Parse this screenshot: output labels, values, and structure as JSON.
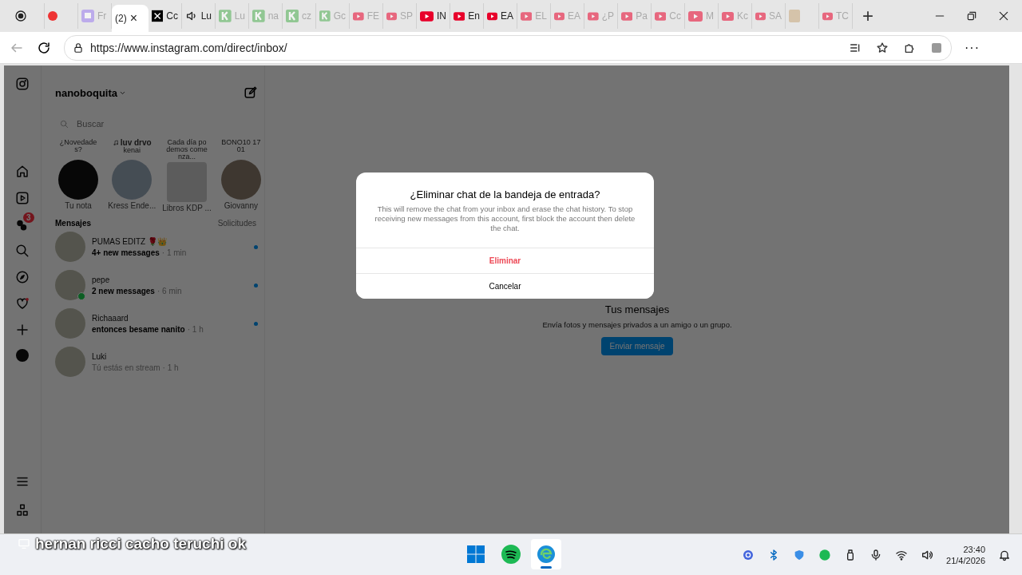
{
  "browser": {
    "tabs": [
      {
        "kind": "record",
        "selected": false,
        "faded": false
      },
      {
        "kind": "dot",
        "selected": false,
        "faded": false
      },
      {
        "kind": "twitch",
        "label": "Fr",
        "selected": false,
        "faded": true
      },
      {
        "kind": "none",
        "label": "(2)",
        "selected": true,
        "faded": false
      },
      {
        "kind": "x",
        "label": "Cc",
        "selected": false,
        "faded": false
      },
      {
        "kind": "speaker",
        "label": "Lu",
        "selected": false,
        "faded": false
      },
      {
        "kind": "k",
        "label": "Lu",
        "selected": false,
        "faded": true
      },
      {
        "kind": "k",
        "label": "na",
        "selected": false,
        "faded": true
      },
      {
        "kind": "k",
        "label": "cz",
        "selected": false,
        "faded": true
      },
      {
        "kind": "k",
        "label": "Gc",
        "selected": false,
        "faded": true
      },
      {
        "kind": "video",
        "label": "FE",
        "selected": false,
        "faded": true
      },
      {
        "kind": "video",
        "label": "SP",
        "selected": false,
        "faded": true
      },
      {
        "kind": "video",
        "label": "IN",
        "selected": false,
        "faded": false
      },
      {
        "kind": "video",
        "label": "En",
        "selected": false,
        "faded": false
      },
      {
        "kind": "video",
        "label": "EA",
        "selected": false,
        "faded": false
      },
      {
        "kind": "video",
        "label": "EL",
        "selected": false,
        "faded": true
      },
      {
        "kind": "video",
        "label": "EA",
        "selected": false,
        "faded": true
      },
      {
        "kind": "video",
        "label": "¿P",
        "selected": false,
        "faded": true
      },
      {
        "kind": "video",
        "label": "Pa",
        "selected": false,
        "faded": true
      },
      {
        "kind": "video",
        "label": "Cc",
        "selected": false,
        "faded": true
      },
      {
        "kind": "video",
        "label": "M",
        "selected": false,
        "faded": true
      },
      {
        "kind": "video",
        "label": "Kc",
        "selected": false,
        "faded": true
      },
      {
        "kind": "video",
        "label": "SA",
        "selected": false,
        "faded": true
      },
      {
        "kind": "image",
        "selected": false,
        "faded": true
      },
      {
        "kind": "video",
        "label": "TC",
        "selected": false,
        "faded": true
      }
    ],
    "tab_close": "×",
    "new_tab": "+",
    "url": "https://www.instagram.com/direct/inbox/",
    "more": "···"
  },
  "sidebar": {
    "notifications_badge": "3"
  },
  "inbox": {
    "username": "nanoboquita",
    "search_placeholder": "Buscar",
    "notes": [
      {
        "bubble": "¿Novedades?",
        "name": "Tu nota",
        "music": false
      },
      {
        "bubble": "luv drvo",
        "sub": "kenai",
        "name": "Kress Ende...",
        "music": true
      },
      {
        "bubble": "Cada día podemos comenza...",
        "name": "Libros KDP ...",
        "music": false
      },
      {
        "bubble": "BONO10 1701",
        "name": "Giovanny",
        "music": false
      }
    ],
    "messages_heading": "Mensajes",
    "requests": "Solicitudes",
    "chats": [
      {
        "name": "PUMAS EDITZ 🌹👑",
        "preview": "4+ new messages",
        "time": "· 1 min",
        "unread": true,
        "online": false
      },
      {
        "name": "pepe",
        "preview": "2 new messages",
        "time": "· 6 min",
        "unread": true,
        "online": true
      },
      {
        "name": "Richaaard",
        "preview": "entonces besame nanito",
        "time": "· 1 h",
        "unread": true,
        "online": false
      },
      {
        "name": "Luki",
        "preview": "Tú estás en stream",
        "time": "· 1 h",
        "unread": false,
        "online": false
      }
    ]
  },
  "main": {
    "title": "Tus mensajes",
    "subtitle": "Envía fotos y mensajes privados a un amigo o un grupo.",
    "button": "Enviar mensaje"
  },
  "dialog": {
    "title": "¿Eliminar chat de la bandeja de entrada?",
    "body": "This will remove the chat from your inbox and erase the chat history. To stop receiving new messages from this account, first block the account then delete the chat.",
    "confirm": "Eliminar",
    "cancel": "Cancelar"
  },
  "stream_chat_overlay": "hernan ricci cacho teruchi ok",
  "taskbar": {
    "apps": [
      {
        "kind": "start",
        "active": false
      },
      {
        "kind": "spotify",
        "active": false
      },
      {
        "kind": "edge",
        "active": true
      }
    ],
    "time": "23:40",
    "date": "21/4/2026"
  }
}
